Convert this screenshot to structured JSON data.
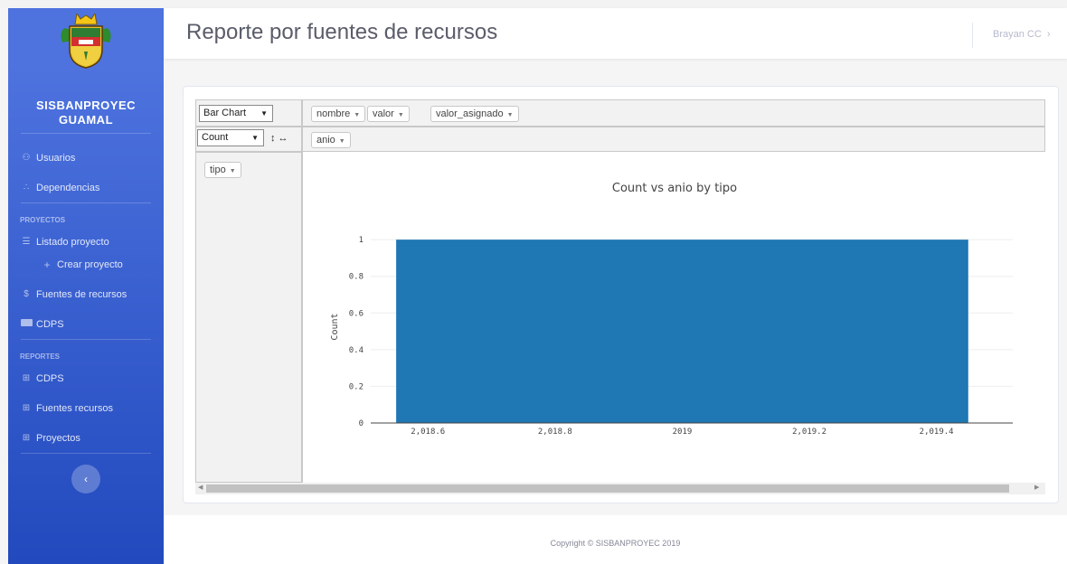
{
  "app": {
    "brand_line1": "SISBANPROYEC",
    "brand_line2": "GUAMAL"
  },
  "sidebar": {
    "items": [
      {
        "label": "Usuarios",
        "icon": "users-icon"
      },
      {
        "label": "Dependencias",
        "icon": "sitemap-icon"
      }
    ],
    "heading_projects": "PROYECTOS",
    "projects": [
      {
        "label": "Listado proyecto",
        "icon": "list-icon"
      },
      {
        "label": "Crear proyecto",
        "icon": "plus-icon"
      },
      {
        "label": "Fuentes de recursos",
        "icon": "dollar-icon"
      },
      {
        "label": "CDPS",
        "icon": "card-icon"
      }
    ],
    "heading_reports": "REPORTES",
    "reports": [
      {
        "label": "CDPS",
        "icon": "table-icon"
      },
      {
        "label": "Fuentes recursos",
        "icon": "table-icon"
      },
      {
        "label": "Proyectos",
        "icon": "table-icon"
      }
    ],
    "toggle_icon": "chevron-left-icon"
  },
  "header": {
    "title": "Reporte por fuentes de recursos",
    "user": "Brayan CC"
  },
  "pivot": {
    "renderer": "Bar Chart",
    "aggregator": "Count",
    "sort_icons": "↕ ↔",
    "unused_attrs": [
      "nombre",
      "valor",
      "valor_asignado"
    ],
    "col_attrs": [
      "anio"
    ],
    "row_attrs": [
      "tipo"
    ]
  },
  "chart_data": {
    "type": "bar",
    "title": "Count vs anio by tipo",
    "xlabel": "",
    "ylabel": "Count",
    "bars": [
      {
        "x_start": 2018.55,
        "x_end": 2019.45,
        "value": 1
      }
    ],
    "xlim": [
      2018.51,
      2019.52
    ],
    "ylim": [
      0,
      1.05
    ],
    "xticks": [
      2018.6,
      2018.8,
      2019,
      2019.2,
      2019.4
    ],
    "xtick_labels": [
      "2,018.6",
      "2,018.8",
      "2019",
      "2,019.2",
      "2,019.4"
    ],
    "yticks": [
      0,
      0.2,
      0.4,
      0.6,
      0.8,
      1
    ],
    "ytick_labels": [
      "0",
      "0.2",
      "0.4",
      "0.6",
      "0.8",
      "1"
    ],
    "bar_color": "#1f77b4",
    "grid": true
  },
  "footer": {
    "text": "Copyright © SISBANPROYEC 2019"
  }
}
